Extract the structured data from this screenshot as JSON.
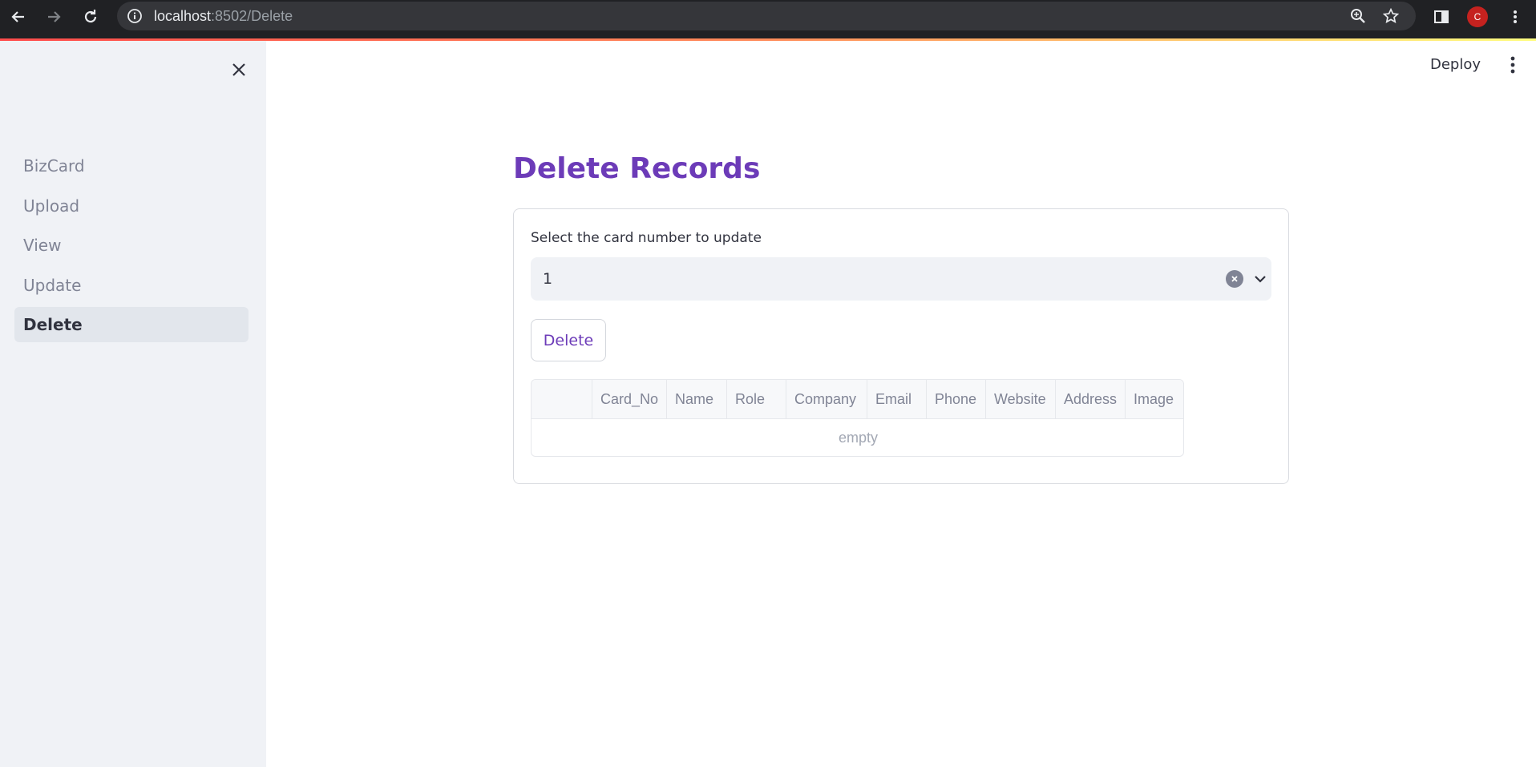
{
  "browser": {
    "url_host": "localhost",
    "url_rest": ":8502/Delete",
    "avatar_letter": "C",
    "icons": [
      "back-arrow-icon",
      "forward-arrow-icon",
      "reload-icon",
      "info-icon",
      "zoom-icon",
      "star-icon",
      "side-panel-icon",
      "kebab-menu-icon"
    ]
  },
  "sidebar": {
    "items": [
      {
        "label": "BizCard",
        "active": false
      },
      {
        "label": "Upload",
        "active": false
      },
      {
        "label": "View",
        "active": false
      },
      {
        "label": "Update",
        "active": false
      },
      {
        "label": "Delete",
        "active": true
      }
    ]
  },
  "header": {
    "deploy_label": "Deploy"
  },
  "main": {
    "title": "Delete Records",
    "select_label": "Select the card number to update",
    "select_value": "1",
    "delete_button": "Delete",
    "table": {
      "columns": [
        "",
        "Card_No",
        "Name",
        "Role",
        "Company",
        "Email",
        "Phone",
        "Website",
        "Address",
        "Image"
      ],
      "empty_text": "empty"
    }
  },
  "colors": {
    "accent": "#6c3bb8",
    "sidebar_bg": "#f0f2f6",
    "chrome_bg": "#202124"
  }
}
